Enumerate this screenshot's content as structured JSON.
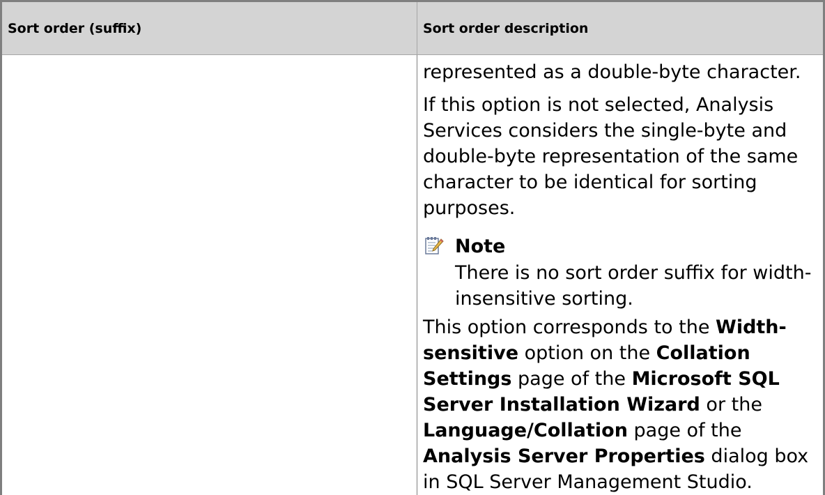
{
  "table": {
    "headers": {
      "col1": "Sort order (suffix)",
      "col2": "Sort order description"
    },
    "row": {
      "col1": "",
      "description": {
        "p1": "represented as a double-byte character.",
        "p2": "If this option is not selected, Analysis Services considers the single-byte and double-byte representation of the same character to be identical for sorting purposes.",
        "note": {
          "icon": "note-pencil-icon",
          "title": "Note",
          "text": "There is no sort order suffix for width-insensitive sorting."
        },
        "p3": {
          "t1": "This option corresponds to the ",
          "b1": "Width-sensitive",
          "t2": " option on the ",
          "b2": "Collation Settings",
          "t3": " page of the ",
          "b3": "Microsoft SQL Server Installation Wizard",
          "t4": " or the ",
          "b4": "Language/Collation",
          "t5": " page of the ",
          "b5": "Analysis Server Properties",
          "t6": " dialog box in SQL Server Management Studio."
        }
      }
    }
  }
}
